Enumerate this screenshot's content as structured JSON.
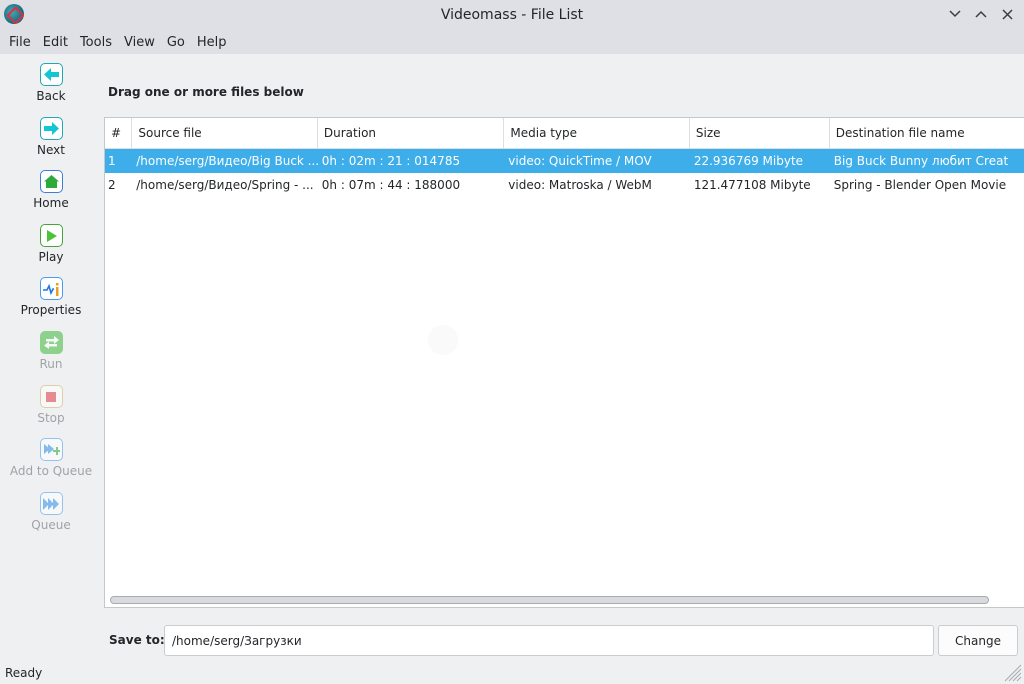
{
  "window": {
    "title": "Videomass - File List",
    "controls": {
      "minimize_icon": "chevron-down",
      "maximize_icon": "chevron-up",
      "close_icon": "x"
    }
  },
  "menubar": {
    "items": [
      {
        "label": "File"
      },
      {
        "label": "Edit"
      },
      {
        "label": "Tools"
      },
      {
        "label": "View"
      },
      {
        "label": "Go"
      },
      {
        "label": "Help"
      }
    ]
  },
  "toolbar": {
    "items": [
      {
        "label": "Back",
        "icon": "arrow-left-icon",
        "enabled": true,
        "color": "#12c7d3",
        "border": "#22a7b0"
      },
      {
        "label": "Next",
        "icon": "arrow-right-icon",
        "enabled": true,
        "color": "#12c7d3",
        "border": "#22a7b0"
      },
      {
        "label": "Home",
        "icon": "home-icon",
        "enabled": true,
        "color": "#2eaa3a",
        "border": "#3c7fd8"
      },
      {
        "label": "Play",
        "icon": "play-icon",
        "enabled": true,
        "color": "#4cc236",
        "border": "#4aa13c"
      },
      {
        "label": "Properties",
        "icon": "info-icon",
        "enabled": true,
        "color": "#1e78e0",
        "border": "#4a9cf0"
      },
      {
        "label": "Run",
        "icon": "swap-arrows-icon",
        "enabled": false,
        "color": "#3fb83a",
        "border": "#3fb83a"
      },
      {
        "label": "Stop",
        "icon": "stop-icon",
        "enabled": false,
        "color": "#e03a42",
        "border": "#d8b070"
      },
      {
        "label": "Add to Queue",
        "icon": "add-to-queue-icon",
        "enabled": false,
        "color": "#2f8ee8",
        "border": "#4a9cf0"
      },
      {
        "label": "Queue",
        "icon": "queue-icon",
        "enabled": false,
        "color": "#2f8ee8",
        "border": "#4a9cf0"
      }
    ]
  },
  "main": {
    "heading": "Drag one or more files below",
    "table": {
      "columns": [
        "#",
        "Source file",
        "Duration",
        "Media type",
        "Size",
        "Destination file name"
      ],
      "rows": [
        {
          "num": "1",
          "source": "/home/serg/Видео/Big Buck ...",
          "duration": "0h : 02m : 21 : 014785",
          "media": "video: QuickTime / MOV",
          "size": "22.936769 Mibyte",
          "dest": "Big Buck Bunny любит Creat",
          "selected": true
        },
        {
          "num": "2",
          "source": "/home/serg/Видео/Spring - ...",
          "duration": "0h : 07m : 44 : 188000",
          "media": "video: Matroska / WebM",
          "size": "121.477108 Mibyte",
          "dest": "Spring - Blender Open Movie",
          "selected": false
        }
      ]
    },
    "save_to": {
      "label": "Save to:",
      "value": "/home/serg/Загрузки",
      "change_label": "Change"
    }
  },
  "status": {
    "text": "Ready"
  }
}
